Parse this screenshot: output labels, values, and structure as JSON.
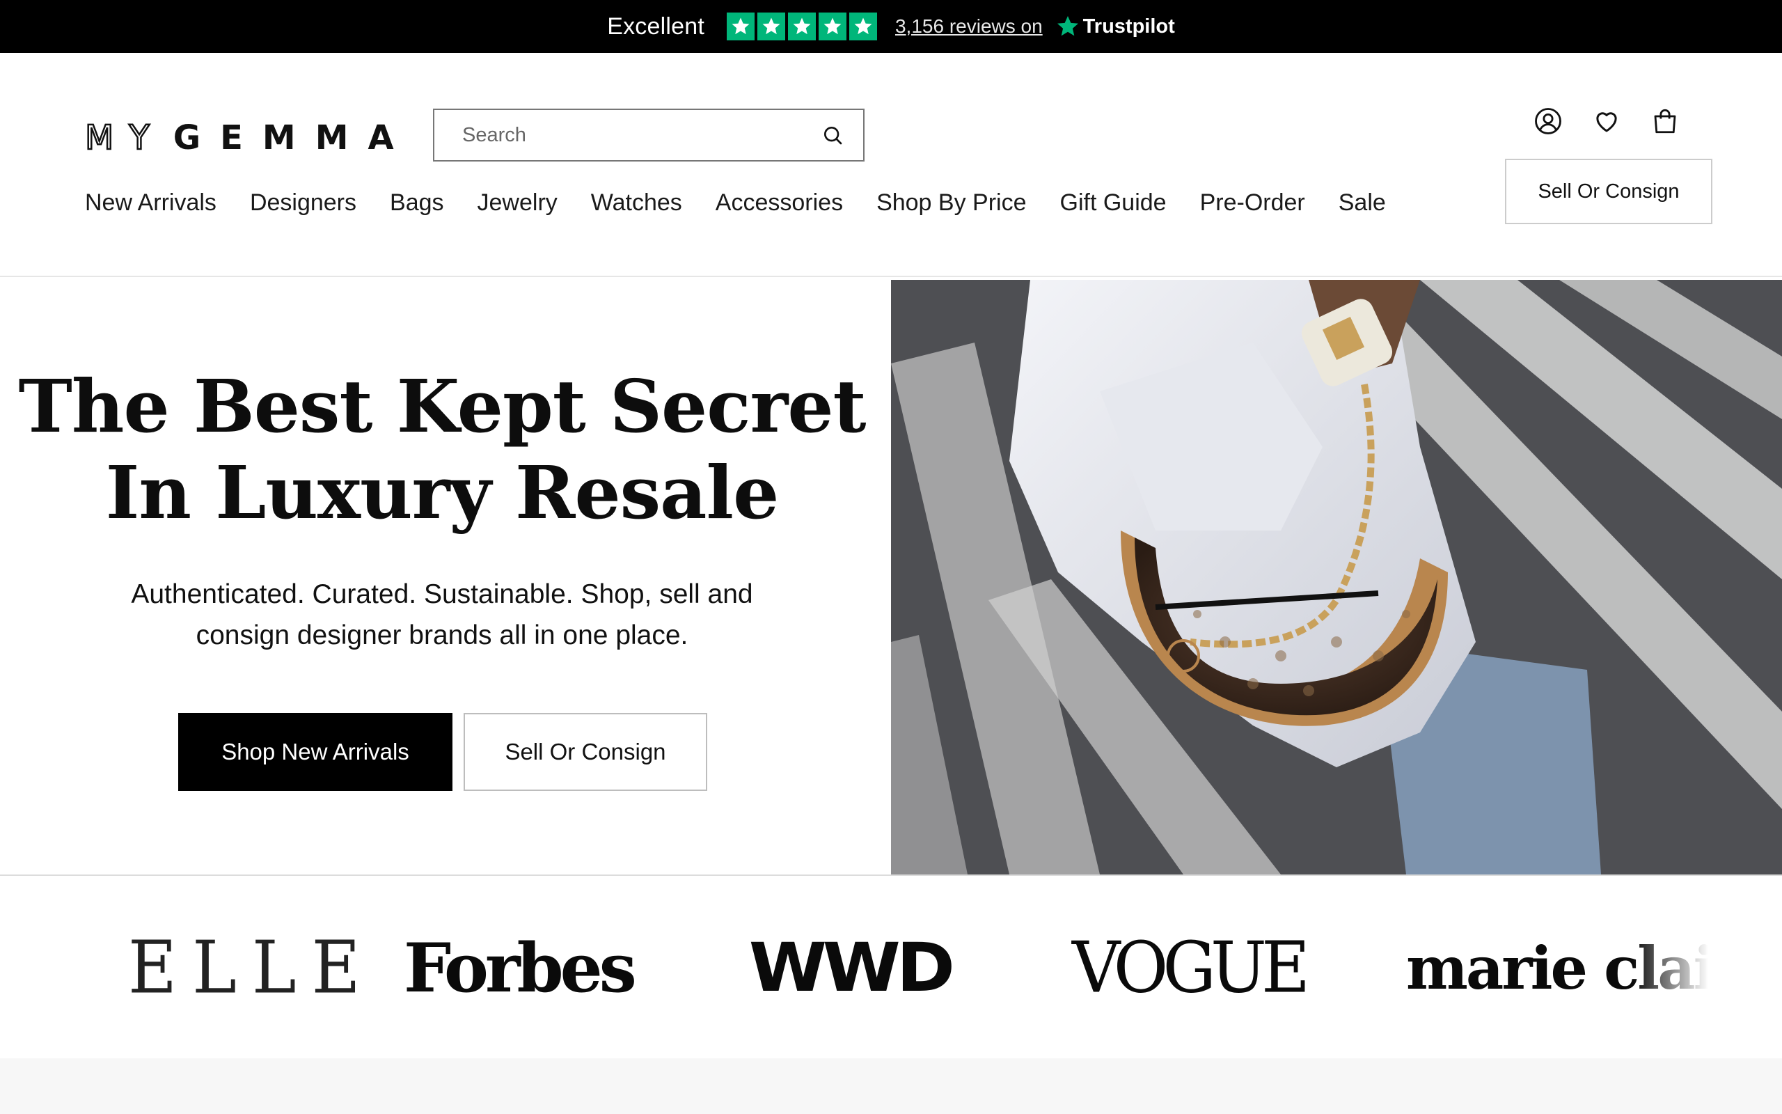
{
  "trustpilot": {
    "rating_word": "Excellent",
    "stars": 5,
    "reviews_text": "3,156 reviews on",
    "brand": "Trustpilot",
    "star_color": "#00b67a"
  },
  "header": {
    "logo_my": "MY",
    "logo_gemma": "GEMMA",
    "search_placeholder": "Search",
    "nav": [
      "New Arrivals",
      "Designers",
      "Bags",
      "Jewelry",
      "Watches",
      "Accessories",
      "Shop By Price",
      "Gift Guide",
      "Pre-Order",
      "Sale"
    ],
    "icons": [
      "account-icon",
      "wishlist-heart-icon",
      "shopping-bag-icon"
    ],
    "sell_button": "Sell Or Consign"
  },
  "hero": {
    "title_line1": "The Best Kept Secret",
    "title_line2": "In Luxury Resale",
    "subtitle": "Authenticated. Curated. Sustainable. Shop, sell and consign designer brands all in one place.",
    "primary_button": "Shop New Arrivals",
    "secondary_button": "Sell Or Consign"
  },
  "press": {
    "logos": [
      "ELLE",
      "Forbes",
      "WWD",
      "VOGUE",
      "marie clair"
    ]
  }
}
